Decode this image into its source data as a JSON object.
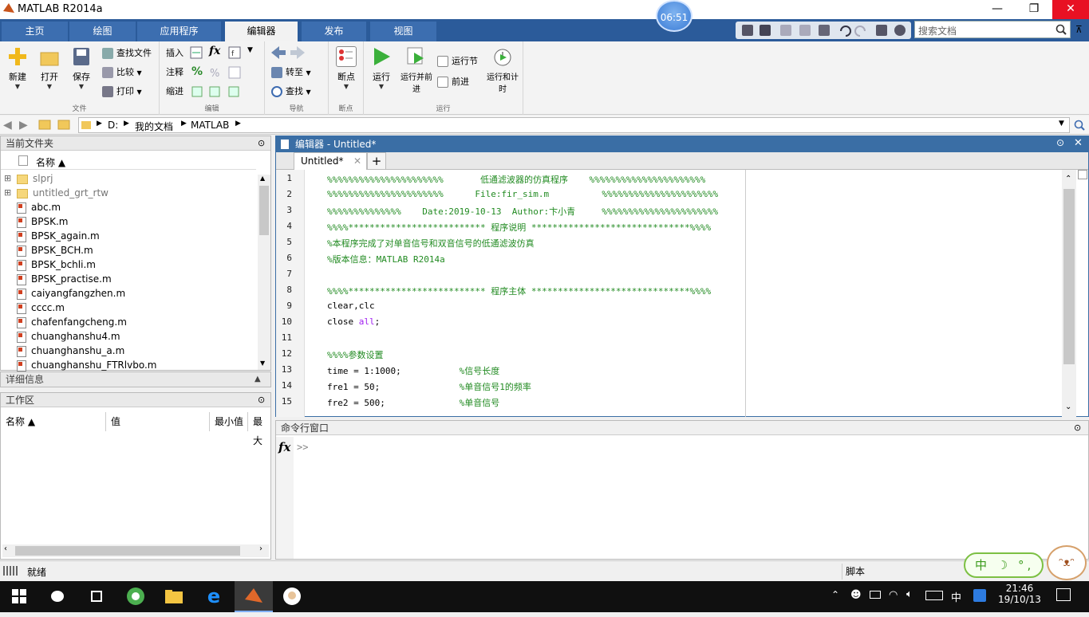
{
  "window": {
    "title": "MATLAB R2014a",
    "minimize": "—",
    "restore": "❐",
    "close": "✕"
  },
  "clock_badge": "06:51",
  "tabs": [
    "主页",
    "绘图",
    "应用程序",
    "编辑器",
    "发布",
    "视图"
  ],
  "search": {
    "placeholder": "搜索文档"
  },
  "ribbon": {
    "file": {
      "label": "文件",
      "new": "新建",
      "open": "打开",
      "save": "保存",
      "find_files": "查找文件",
      "compare": "比较",
      "print": "打印"
    },
    "edit": {
      "label": "编辑",
      "insert": "插入",
      "comment": "注释",
      "indent": "缩进",
      "fx": "fx"
    },
    "navigate": {
      "label": "导航",
      "goto": "转至",
      "find": "查找"
    },
    "breakpoints": {
      "label": "断点",
      "breakpoints": "断点"
    },
    "run": {
      "label": "运行",
      "run": "运行",
      "run_advance": "运行并前进",
      "run_section": "运行节",
      "advance": "前进",
      "run_time": "运行和计时"
    }
  },
  "address": {
    "drive": "D:",
    "folder1": "我的文档",
    "folder2": "MATLAB"
  },
  "current_folder": {
    "title": "当前文件夹",
    "column": "名称 ▲",
    "items": [
      {
        "name": "slprj",
        "type": "folder"
      },
      {
        "name": "untitled_grt_rtw",
        "type": "folder"
      },
      {
        "name": "abc.m",
        "type": "file"
      },
      {
        "name": "BPSK.m",
        "type": "file"
      },
      {
        "name": "BPSK_again.m",
        "type": "file"
      },
      {
        "name": "BPSK_BCH.m",
        "type": "file"
      },
      {
        "name": "BPSK_bchli.m",
        "type": "file"
      },
      {
        "name": "BPSK_practise.m",
        "type": "file"
      },
      {
        "name": "caiyangfangzhen.m",
        "type": "file"
      },
      {
        "name": "cccc.m",
        "type": "file"
      },
      {
        "name": "chafenfangcheng.m",
        "type": "file"
      },
      {
        "name": "chuanghanshu4.m",
        "type": "file"
      },
      {
        "name": "chuanghanshu_a.m",
        "type": "file"
      },
      {
        "name": "chuanghanshu_FTRlvbo.m",
        "type": "file"
      }
    ]
  },
  "details": {
    "title": "详细信息"
  },
  "workspace": {
    "title": "工作区",
    "columns": [
      "名称 ▲",
      "值",
      "最小值",
      "最大"
    ]
  },
  "editor": {
    "title": "编辑器 - Untitled*",
    "tab": "Untitled*",
    "lines": [
      {
        "n": "1",
        "segments": [
          {
            "t": "%%%%%%%%%%%%%%%%%%%%%%       低通滤波器的仿真程序    %%%%%%%%%%%%%%%%%%%%%%",
            "c": "cm"
          }
        ]
      },
      {
        "n": "2",
        "segments": [
          {
            "t": "%%%%%%%%%%%%%%%%%%%%%%      File:fir_sim.m          %%%%%%%%%%%%%%%%%%%%%%",
            "c": "cm"
          }
        ]
      },
      {
        "n": "3",
        "segments": [
          {
            "t": "%%%%%%%%%%%%%%    Date:2019-10-13  Author:卞小青     %%%%%%%%%%%%%%%%%%%%%%",
            "c": "cm"
          }
        ]
      },
      {
        "n": "4",
        "segments": [
          {
            "t": "%%%%************************** 程序说明 ******************************%%%%",
            "c": "cm"
          }
        ]
      },
      {
        "n": "5",
        "segments": [
          {
            "t": "%本程序完成了对单音信号和双音信号的低通滤波仿真",
            "c": "cm"
          }
        ]
      },
      {
        "n": "6",
        "segments": [
          {
            "t": "%版本信息：MATLAB R2014a",
            "c": "cm"
          }
        ]
      },
      {
        "n": "7",
        "segments": []
      },
      {
        "n": "8",
        "segments": [
          {
            "t": "%%%%************************** 程序主体 ******************************%%%%",
            "c": "cm"
          }
        ]
      },
      {
        "n": "9",
        "segments": [
          {
            "t": "clear,clc",
            "c": ""
          }
        ]
      },
      {
        "n": "10",
        "segments": [
          {
            "t": "close ",
            "c": ""
          },
          {
            "t": "all",
            "c": "kw"
          },
          {
            "t": ";",
            "c": ""
          }
        ]
      },
      {
        "n": "11",
        "segments": []
      },
      {
        "n": "12",
        "segments": [
          {
            "t": "%%%%参数设置",
            "c": "cm"
          }
        ]
      },
      {
        "n": "13",
        "segments": [
          {
            "t": "time = 1:1000;           ",
            "c": ""
          },
          {
            "t": "%信号长度",
            "c": "cm"
          }
        ]
      },
      {
        "n": "14",
        "segments": [
          {
            "t": "fre1 = 50;               ",
            "c": ""
          },
          {
            "t": "%单音信号1的频率",
            "c": "cm"
          }
        ]
      },
      {
        "n": "15",
        "segments": [
          {
            "t": "fre2 = 500;              ",
            "c": ""
          },
          {
            "t": "%单音信号",
            "c": "cm"
          }
        ]
      }
    ]
  },
  "command_window": {
    "title": "命令行窗口",
    "fx": "fx",
    "prompt": ">>"
  },
  "status": {
    "text": "就绪",
    "right": "脚本"
  },
  "ime": "中 ☽ °, ✿",
  "taskbar": {
    "time": "21:46",
    "date": "19/10/13",
    "ime_lang": "中"
  }
}
